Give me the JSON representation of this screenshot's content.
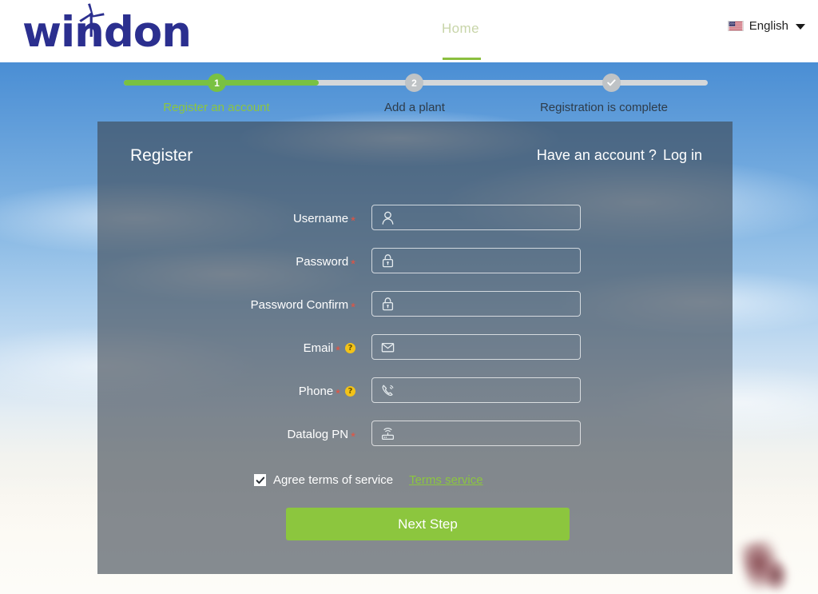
{
  "header": {
    "logo_text": "windon",
    "logo_icon": "wind-turbine-icon",
    "nav": [
      {
        "label": "Home",
        "active": true
      }
    ],
    "language": {
      "label": "English",
      "flag_icon": "us-flag-icon",
      "caret_icon": "chevron-down-icon"
    }
  },
  "stepper": {
    "steps": [
      {
        "number": "1",
        "label": "Register an account",
        "state": "active"
      },
      {
        "number": "2",
        "label": "Add a plant",
        "state": "inactive"
      },
      {
        "number": "✓",
        "label": "Registration is complete",
        "state": "inactive",
        "icon": "check-icon"
      }
    ],
    "colors": {
      "active": "#79c142",
      "inactive": "#bfc3c6",
      "active_label": "#8cc63f",
      "inactive_label": "#2e3c4a"
    }
  },
  "panel": {
    "title": "Register",
    "account_prompt": "Have an account ?",
    "login_label": "Log in"
  },
  "form": {
    "fields": [
      {
        "label": "Username",
        "required": true,
        "help": false,
        "icon": "user-icon",
        "value": "",
        "placeholder": ""
      },
      {
        "label": "Password",
        "required": true,
        "help": false,
        "icon": "lock-icon",
        "value": "",
        "placeholder": ""
      },
      {
        "label": "Password Confirm",
        "required": true,
        "help": false,
        "icon": "lock-icon",
        "value": "",
        "placeholder": ""
      },
      {
        "label": "Email",
        "required": true,
        "help": true,
        "icon": "envelope-icon",
        "value": "",
        "placeholder": ""
      },
      {
        "label": "Phone",
        "required": true,
        "help": true,
        "icon": "phone-icon",
        "value": "",
        "placeholder": ""
      },
      {
        "label": "Datalog PN",
        "required": true,
        "help": false,
        "icon": "router-icon",
        "value": "",
        "placeholder": ""
      }
    ],
    "required_marker": "*",
    "help_marker": "?",
    "agree_label": "Agree terms of service",
    "agree_checked": true,
    "terms_link": "Terms service",
    "submit_label": "Next Step"
  },
  "colors": {
    "brand_navy": "#2b2f8f",
    "accent_green": "#8cc63e",
    "required_red": "#e8523f",
    "help_yellow": "#f3c318",
    "panel_overlay": "rgba(60,70,80,0.62)"
  }
}
